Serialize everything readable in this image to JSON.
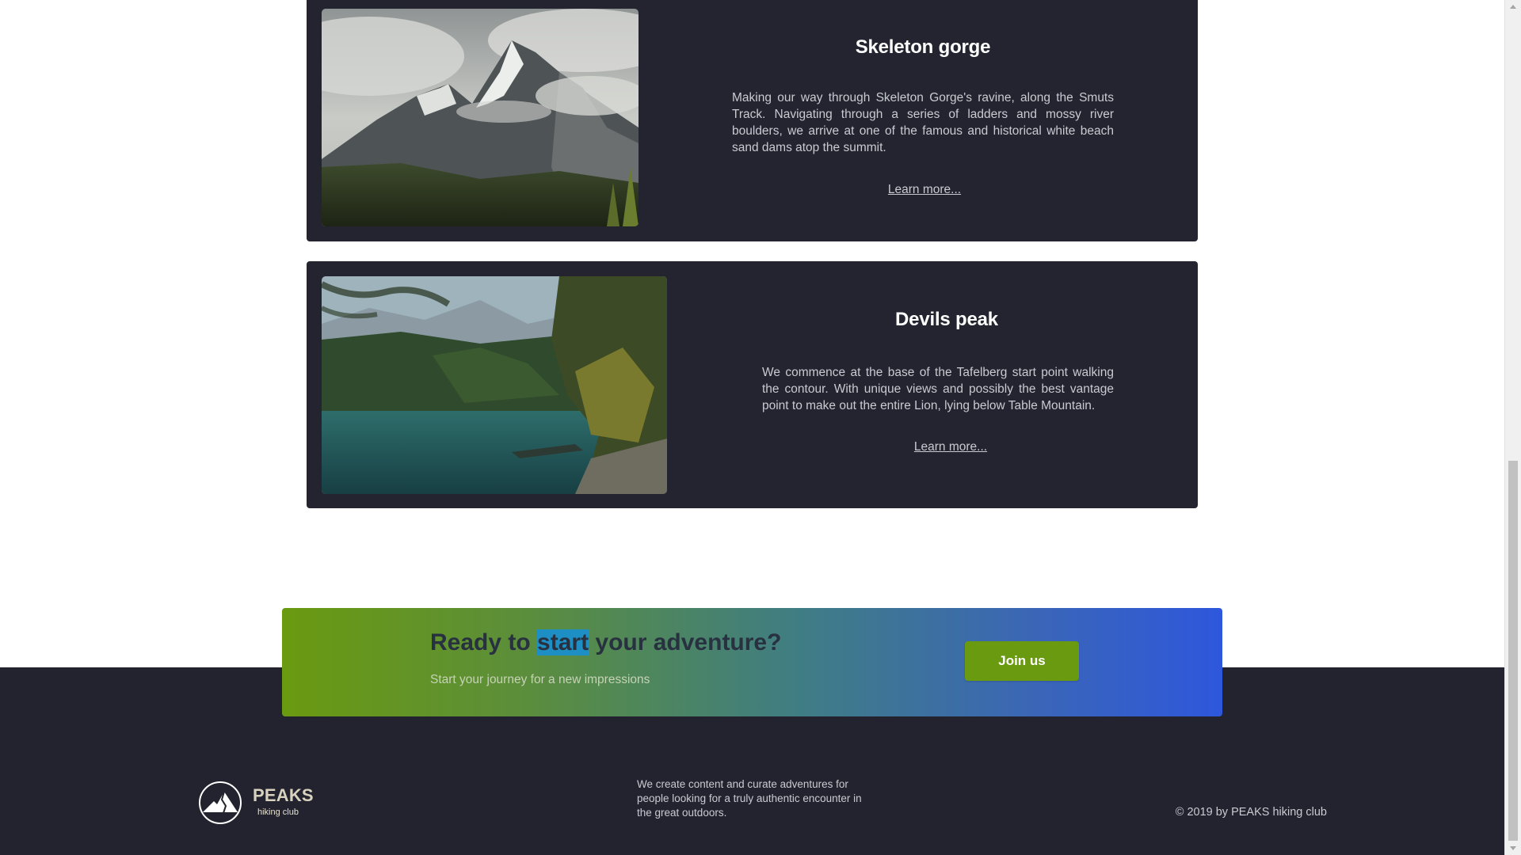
{
  "cards": [
    {
      "title": "Skeleton gorge",
      "description": "Making our way through Skeleton Gorge's ravine, along the Smuts Track. Navigating through a series of ladders and mossy river boulders, we arrive at one of the famous and historical white beach sand dams atop the summit.",
      "link": "Learn more..."
    },
    {
      "title": "Devils peak",
      "description": "We commence at the base of the Tafelberg start point walking the contour. With unique views and possibly the best vantage point to make out the entire Lion, lying below Table Mountain.",
      "link": "Learn more..."
    }
  ],
  "cta": {
    "headline_before": "Ready to ",
    "headline_highlight": "start",
    "headline_after": " your adventure?",
    "subtitle": "Start your journey for a new impressions",
    "button_label": "Join us"
  },
  "footer": {
    "brand_name": "PEAKS",
    "brand_tagline": "hiking club",
    "about": "We create content and curate adventures for people looking for a truly authentic encounter in the great outdoors.",
    "copyright": "© 2019 by PEAKS hiking club"
  },
  "colors": {
    "card_bg": "#23242f",
    "footer_bg": "#22232e",
    "accent_green": "#6a9a10",
    "accent_blue": "#2e57dc",
    "highlight": "#1e8fc4"
  },
  "icons": {
    "logo": "mountain-logo-icon",
    "scroll_up": "scroll-up-arrow-icon",
    "scroll_down": "scroll-down-arrow-icon"
  }
}
